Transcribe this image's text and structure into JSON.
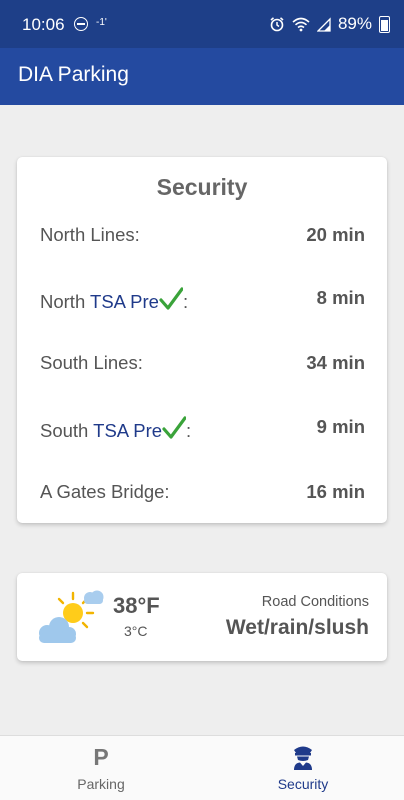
{
  "status_bar": {
    "time": "10:06",
    "small_label": "-1'",
    "battery": "89%"
  },
  "app_bar": {
    "title": "DIA Parking"
  },
  "security": {
    "title": "Security",
    "rows": [
      {
        "prefix": "North Lines:",
        "tsa": "",
        "suffix": "",
        "value": "20 min"
      },
      {
        "prefix": "North ",
        "tsa": "TSA Pre",
        "suffix": ":",
        "value": "8 min"
      },
      {
        "prefix": "South Lines:",
        "tsa": "",
        "suffix": "",
        "value": "34 min"
      },
      {
        "prefix": "South ",
        "tsa": "TSA Pre",
        "suffix": ":",
        "value": "9 min"
      },
      {
        "prefix": "A Gates Bridge:",
        "tsa": "",
        "suffix": "",
        "value": "16 min"
      }
    ]
  },
  "weather": {
    "icon": "partly-sunny-icon",
    "temp_f": "38°F",
    "temp_c": "3°C",
    "conditions_label": "Road Conditions",
    "conditions_value": "Wet/rain/slush"
  },
  "bottom_nav": {
    "items": [
      {
        "icon": "P",
        "label": "Parking",
        "active": false
      },
      {
        "icon": "security-officer-icon",
        "label": "Security",
        "active": true
      }
    ]
  },
  "colors": {
    "status_bar": "#1e3f88",
    "app_bar": "#244aa0",
    "tsa_text": "#1f3a8a",
    "tsa_check": "#3aa33a",
    "active_nav": "#1f3a8a"
  }
}
